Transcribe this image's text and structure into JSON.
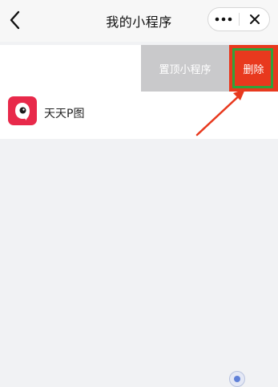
{
  "navbar": {
    "title": "我的小程序",
    "back_icon": "chevron-left-icon",
    "more_icon": "more-dots-icon",
    "close_icon": "close-icon"
  },
  "mini_program_item": {
    "name": "天天P图",
    "icon": "camera-lens-icon",
    "icon_color": "#e8294a"
  },
  "swipe_actions": {
    "pin_label": "置顶小程序",
    "delete_label": "删除",
    "pin_color": "#c9c9cb",
    "delete_color": "#e8391e",
    "highlight_color": "#2ea43a"
  },
  "annotation": {
    "arrow_color": "#e8391e"
  }
}
